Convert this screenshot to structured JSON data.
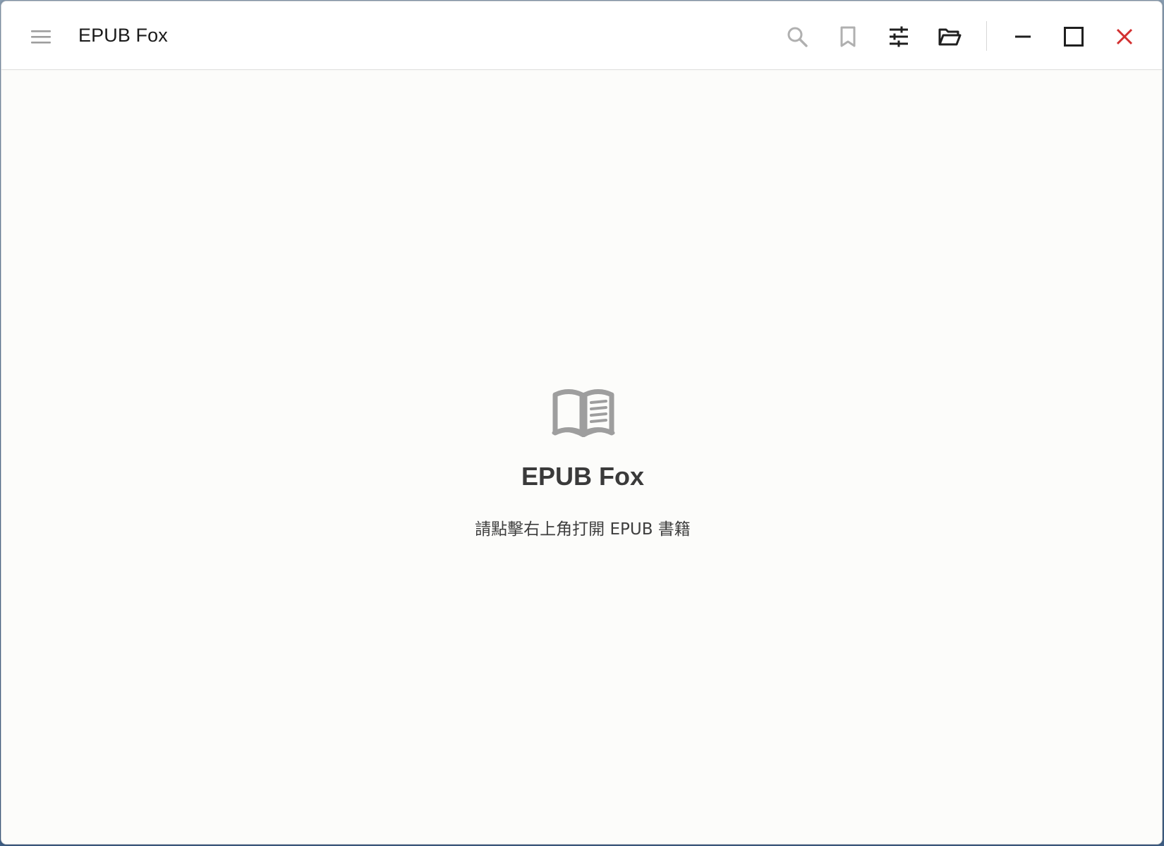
{
  "window": {
    "title": "EPUB Fox"
  },
  "toolbar": {
    "icons": {
      "menu": "menu-icon",
      "search": "search-icon",
      "bookmark": "bookmark-icon",
      "settings": "tune-icon",
      "open": "folder-open-icon",
      "minimize": "minimize-icon",
      "maximize": "maximize-icon",
      "close": "close-icon"
    }
  },
  "empty_state": {
    "icon": "open-book-icon",
    "title": "EPUB Fox",
    "subtitle": "請點擊右上角打開 EPUB 書籍"
  },
  "colors": {
    "close": "#d32f2f",
    "disabled_icon": "#b0b0b0",
    "active_icon": "#1f1f1f",
    "book_icon": "#9e9e9e"
  }
}
